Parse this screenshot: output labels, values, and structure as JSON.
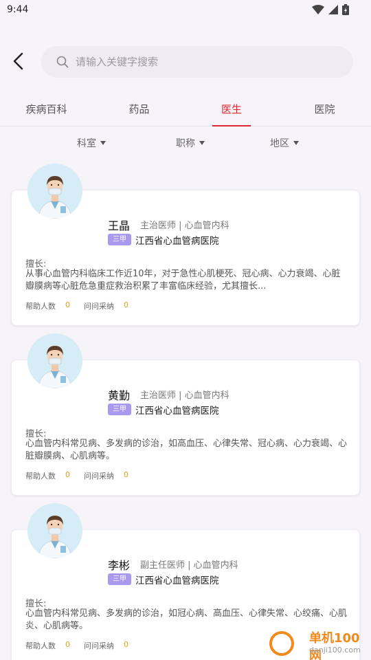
{
  "status": {
    "time": "9:44"
  },
  "search": {
    "placeholder": "请输入关键字搜索",
    "value": ""
  },
  "tabs": [
    {
      "label": "疾病百科",
      "active": false
    },
    {
      "label": "药品",
      "active": false
    },
    {
      "label": "医生",
      "active": true
    },
    {
      "label": "医院",
      "active": false
    }
  ],
  "filters": [
    {
      "label": "科室"
    },
    {
      "label": "职称"
    },
    {
      "label": "地区"
    }
  ],
  "doctors": [
    {
      "name": "王晶",
      "title": "主治医师 | 心血管内科",
      "badge": "三甲",
      "hospital": "江西省心血管病医院",
      "spec_label": "擅长:",
      "spec": "从事心血管内科临床工作近10年，对于急性心肌梗死、冠心病、心力衰竭、心脏瓣膜病等心脏危急重症救治积累了丰富临床经验，尤其擅长...",
      "help_label": "帮助人数",
      "help_count": "0",
      "adopt_label": "问问采纳",
      "adopt_count": "0"
    },
    {
      "name": "黄勤",
      "title": "主治医师 | 心血管内科",
      "badge": "三甲",
      "hospital": "江西省心血管病医院",
      "spec_label": "擅长:",
      "spec": "心血管内科常见病、多发病的诊治，如高血压、心律失常、冠心病、心力衰竭、心脏瓣膜病、心肌病等。",
      "help_label": "帮助人数",
      "help_count": "0",
      "adopt_label": "问问采纳",
      "adopt_count": "0"
    },
    {
      "name": "李彬",
      "title": "副主任医师 | 心血管内科",
      "badge": "三甲",
      "hospital": "江西省心血管病医院",
      "spec_label": "擅长:",
      "spec": "心血管内科常见病、多发病的诊治，如冠心病、高血压、心律失常、心绞痛、心肌炎、心肌病等。",
      "help_label": "帮助人数",
      "help_count": "0",
      "adopt_label": "问问采纳",
      "adopt_count": "0"
    }
  ],
  "watermark": {
    "text": "单机100网",
    "url": "danji100.com"
  },
  "colors": {
    "accent": "#e0262f",
    "badge": "#a99af0",
    "count": "#e0a21a"
  }
}
